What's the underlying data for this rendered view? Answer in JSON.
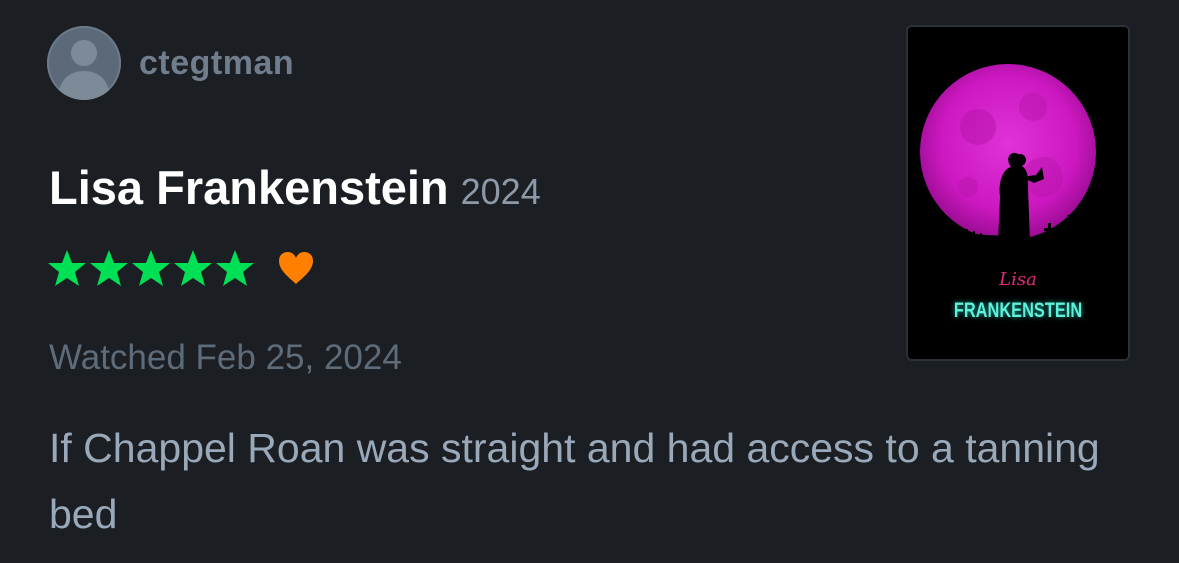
{
  "user": {
    "username": "ctegtman",
    "avatar_icon": "person-icon"
  },
  "film": {
    "title": "Lisa Frankenstein",
    "year": "2024"
  },
  "rating": {
    "stars": 5,
    "max_stars": 5,
    "liked": true,
    "star_color": "#00e054",
    "heart_color": "#ff8000"
  },
  "watched": {
    "text": "Watched Feb 25, 2024"
  },
  "review": {
    "text": "If Chappel Roan was straight and had access to a tanning bed"
  },
  "poster": {
    "script_text": "Lisa",
    "title_text": "FRANKENSTEIN",
    "moon_color": "#d31bc9"
  }
}
